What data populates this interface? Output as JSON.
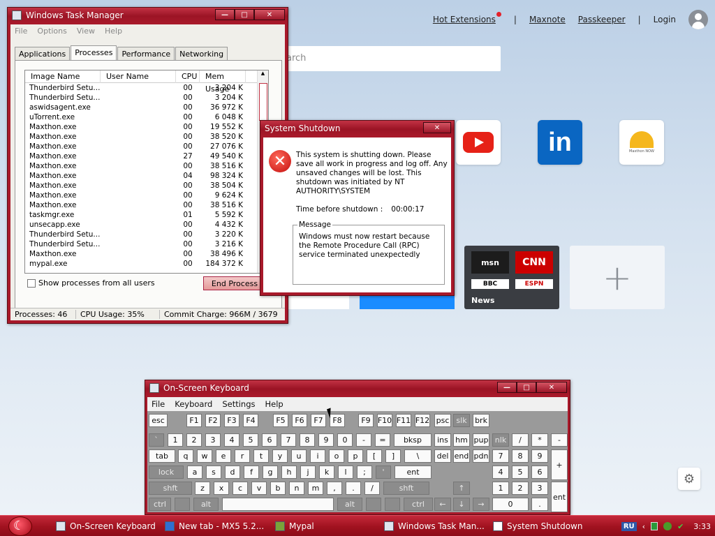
{
  "browser": {
    "nav": {
      "hot_extensions": "Hot Extensions",
      "sep1": "|",
      "maxnote": "Maxnote",
      "passkeeper": "Passkeeper",
      "sep2": "|",
      "login": "Login"
    },
    "search_placeholder": "arch",
    "tiles": {
      "youtube": "youtube-icon",
      "linkedin": "in",
      "maxthon_now": "Maxthon NOW"
    },
    "news_tile": {
      "msn": "msn",
      "cnn": "CNN",
      "bbc": "BBC",
      "espn": "ESPN",
      "label": "News"
    },
    "add_tile": "+"
  },
  "task_manager": {
    "title": "Windows Task Manager",
    "menu": [
      "File",
      "Options",
      "View",
      "Help"
    ],
    "tabs": [
      "Applications",
      "Processes",
      "Performance",
      "Networking"
    ],
    "active_tab": "Processes",
    "columns": [
      "Image Name",
      "User Name",
      "CPU",
      "Mem Usage"
    ],
    "processes": [
      {
        "name": "Thunderbird Setu...",
        "user": "",
        "cpu": "00",
        "mem": "3 204 K"
      },
      {
        "name": "Thunderbird Setu...",
        "user": "",
        "cpu": "00",
        "mem": "3 204 K"
      },
      {
        "name": "aswidsagent.exe",
        "user": "",
        "cpu": "00",
        "mem": "36 972 K"
      },
      {
        "name": "uTorrent.exe",
        "user": "",
        "cpu": "00",
        "mem": "6 048 K"
      },
      {
        "name": "Maxthon.exe",
        "user": "",
        "cpu": "00",
        "mem": "19 552 K"
      },
      {
        "name": "Maxthon.exe",
        "user": "",
        "cpu": "00",
        "mem": "38 520 K"
      },
      {
        "name": "Maxthon.exe",
        "user": "",
        "cpu": "00",
        "mem": "27 076 K"
      },
      {
        "name": "Maxthon.exe",
        "user": "",
        "cpu": "27",
        "mem": "49 540 K"
      },
      {
        "name": "Maxthon.exe",
        "user": "",
        "cpu": "00",
        "mem": "38 516 K"
      },
      {
        "name": "Maxthon.exe",
        "user": "",
        "cpu": "04",
        "mem": "98 324 K"
      },
      {
        "name": "Maxthon.exe",
        "user": "",
        "cpu": "00",
        "mem": "38 504 K"
      },
      {
        "name": "Maxthon.exe",
        "user": "",
        "cpu": "00",
        "mem": "9 624 K"
      },
      {
        "name": "Maxthon.exe",
        "user": "",
        "cpu": "00",
        "mem": "38 516 K"
      },
      {
        "name": "taskmgr.exe",
        "user": "",
        "cpu": "01",
        "mem": "5 592 K"
      },
      {
        "name": "unsecapp.exe",
        "user": "",
        "cpu": "00",
        "mem": "4 432 K"
      },
      {
        "name": "Thunderbird Setu...",
        "user": "",
        "cpu": "00",
        "mem": "3 220 K"
      },
      {
        "name": "Thunderbird Setu...",
        "user": "",
        "cpu": "00",
        "mem": "3 216 K"
      },
      {
        "name": "Maxthon.exe",
        "user": "",
        "cpu": "00",
        "mem": "38 496 K"
      },
      {
        "name": "mypal.exe",
        "user": "",
        "cpu": "00",
        "mem": "184 372 K"
      }
    ],
    "show_all_label": "Show processes from all users",
    "end_process": "End Process",
    "status": {
      "processes": "Processes: 46",
      "cpu": "CPU Usage: 35%",
      "commit": "Commit Charge: 966M / 3679"
    }
  },
  "shutdown": {
    "title": "System Shutdown",
    "message": "This system is shutting down. Please save all work in progress and log off. Any unsaved changes will be lost. This shutdown was initiated by NT AUTHORITY\\SYSTEM",
    "time_label": "Time before shutdown :",
    "time_value": "00:00:17",
    "legend": "Message",
    "detail": "Windows must now restart because the Remote Procedure Call (RPC) service terminated unexpectedly"
  },
  "osk": {
    "title": "On-Screen Keyboard",
    "menu": [
      "File",
      "Keyboard",
      "Settings",
      "Help"
    ],
    "keys": {
      "r1": [
        "esc",
        "F1",
        "F2",
        "F3",
        "F4",
        "F5",
        "F6",
        "F7",
        "F8",
        "F9",
        "F10",
        "F11",
        "F12",
        "psc",
        "slk",
        "brk"
      ],
      "r2": [
        "`",
        "1",
        "2",
        "3",
        "4",
        "5",
        "6",
        "7",
        "8",
        "9",
        "0",
        "-",
        "=",
        "bksp",
        "ins",
        "hm",
        "pup",
        "nlk",
        "/",
        "*",
        "-"
      ],
      "r3": [
        "tab",
        "q",
        "w",
        "e",
        "r",
        "t",
        "y",
        "u",
        "i",
        "o",
        "p",
        "[",
        "]",
        "\\",
        "del",
        "end",
        "pdn",
        "7",
        "8",
        "9",
        "+"
      ],
      "r4": [
        "lock",
        "a",
        "s",
        "d",
        "f",
        "g",
        "h",
        "j",
        "k",
        "l",
        ";",
        "'",
        "ent",
        "4",
        "5",
        "6"
      ],
      "r5": [
        "shft",
        "z",
        "x",
        "c",
        "v",
        "b",
        "n",
        "m",
        ",",
        ".",
        "/",
        "shft",
        "↑",
        "1",
        "2",
        "3",
        "ent"
      ],
      "r6": [
        "ctrl",
        "",
        "alt",
        "",
        "alt",
        "",
        "",
        "ctrl",
        "←",
        "↓",
        "→",
        "0",
        "."
      ]
    }
  },
  "taskbar": {
    "items": [
      "On-Screen Keyboard",
      "New tab - MX5 5.2...",
      "Mypal",
      "Windows Task Man...",
      "System Shutdown"
    ],
    "lang": "RU",
    "clock": "3:33"
  }
}
